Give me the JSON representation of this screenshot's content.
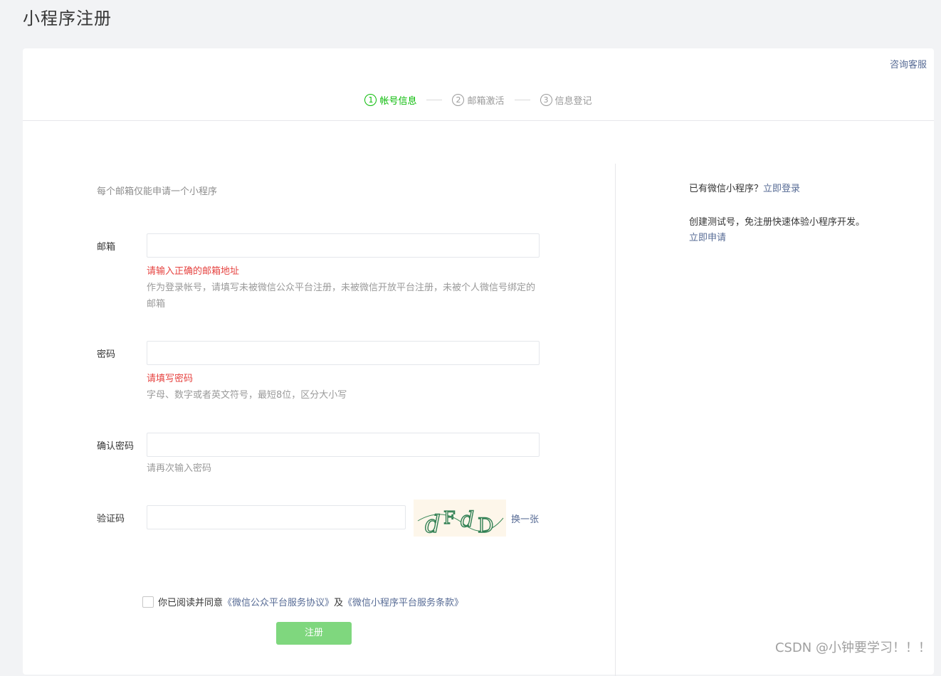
{
  "page": {
    "title": "小程序注册"
  },
  "help": {
    "label": "咨询客服"
  },
  "steps": [
    {
      "num": "1",
      "label": "帐号信息",
      "active": true
    },
    {
      "num": "2",
      "label": "邮箱激活",
      "active": false
    },
    {
      "num": "3",
      "label": "信息登记",
      "active": false
    }
  ],
  "form": {
    "intro": "每个邮箱仅能申请一个小程序",
    "email": {
      "label": "邮箱",
      "value": "",
      "error": "请输入正确的邮箱地址",
      "hint": "作为登录帐号，请填写未被微信公众平台注册，未被微信开放平台注册，未被个人微信号绑定的邮箱"
    },
    "password": {
      "label": "密码",
      "value": "",
      "error": "请填写密码",
      "hint": "字母、数字或者英文符号，最短8位，区分大小写"
    },
    "confirm": {
      "label": "确认密码",
      "value": "",
      "hint": "请再次输入密码"
    },
    "captcha": {
      "label": "验证码",
      "value": "",
      "image_text": "dFdD",
      "refresh_label": "换一张"
    },
    "agreement": {
      "prefix": "你已阅读并同意",
      "link1": "《微信公众平台服务协议》",
      "middle": "及",
      "link2": "《微信小程序平台服务条款》",
      "checked": false
    },
    "submit_label": "注册"
  },
  "sidebar": {
    "login_prompt": "已有微信小程序？",
    "login_link": "立即登录",
    "test_prompt": "创建测试号，免注册快速体验小程序开发。",
    "test_link": "立即申请"
  },
  "watermark": "CSDN @小钟要学习！！！",
  "colors": {
    "accent": "#09bb07",
    "link": "#576b95",
    "error": "#e64340",
    "button_disabled": "#7fd77e"
  }
}
